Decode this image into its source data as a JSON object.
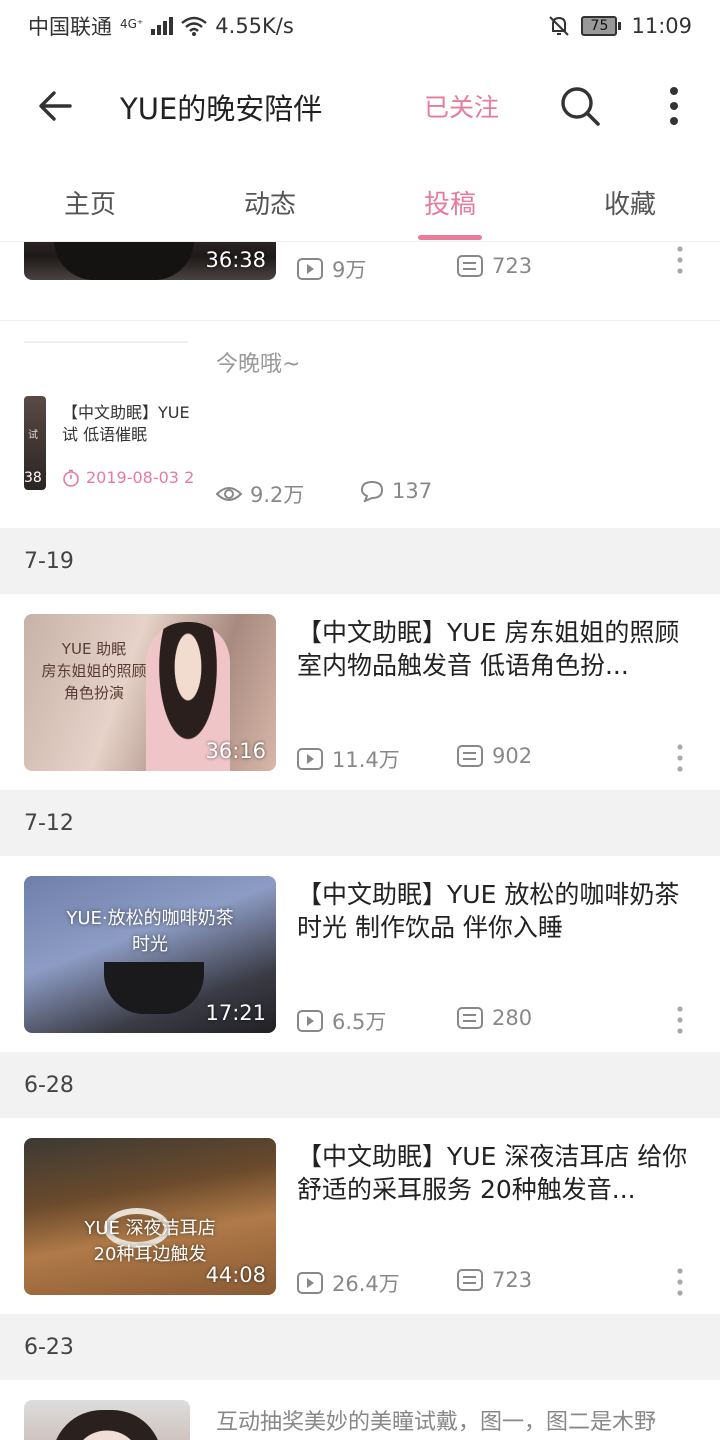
{
  "status_bar": {
    "carrier": "中国联通",
    "network": "4G⁺",
    "speed": "4.55K/s",
    "battery": "75",
    "time": "11:09"
  },
  "header": {
    "title": "YUE的晚安陪伴",
    "follow_label": "已关注"
  },
  "tabs": [
    {
      "label": "主页",
      "active": false
    },
    {
      "label": "动态",
      "active": false
    },
    {
      "label": "投稿",
      "active": true
    },
    {
      "label": "收藏",
      "active": false
    }
  ],
  "colors": {
    "accent": "#e87b9c",
    "date_bg": "#f2f2f2"
  },
  "top_partial_item": {
    "duration": "36:38",
    "views": "9万",
    "comments": "723"
  },
  "dynamic_post": {
    "text": "今晚哦~",
    "card_title": "【中文助眠】YUE 试 低语催眠",
    "card_date": "2019-08-03 2",
    "card_thumb_text": "试",
    "card_thumb_duration": "38",
    "views": "9.2万",
    "comments": "137"
  },
  "sections": [
    {
      "date": "7-19",
      "video": {
        "title": "【中文助眠】YUE 房东姐姐的照顾 室内物品触发音 低语角色扮...",
        "thumb_caption_1": "YUE 助眠",
        "thumb_caption_2": "房东姐姐的照顾",
        "thumb_caption_3": "角色扮演",
        "duration": "36:16",
        "views": "11.4万",
        "comments": "902"
      }
    },
    {
      "date": "7-12",
      "video": {
        "title": "【中文助眠】YUE 放松的咖啡奶茶时光 制作饮品 伴你入睡",
        "thumb_caption_1": "YUE·放松的咖啡奶茶",
        "thumb_caption_2": "时光",
        "duration": "17:21",
        "views": "6.5万",
        "comments": "280"
      }
    },
    {
      "date": "6-28",
      "video": {
        "title": "【中文助眠】YUE 深夜洁耳店 给你舒适的采耳服务 20种触发音...",
        "thumb_caption_1": "YUE 深夜洁耳店",
        "thumb_caption_2": "20种耳边触发",
        "duration": "44:08",
        "views": "26.4万",
        "comments": "723"
      }
    },
    {
      "date": "6-23",
      "post_text": "互动抽奖美妙的美瞳试戴，图一，图二是木野"
    }
  ]
}
